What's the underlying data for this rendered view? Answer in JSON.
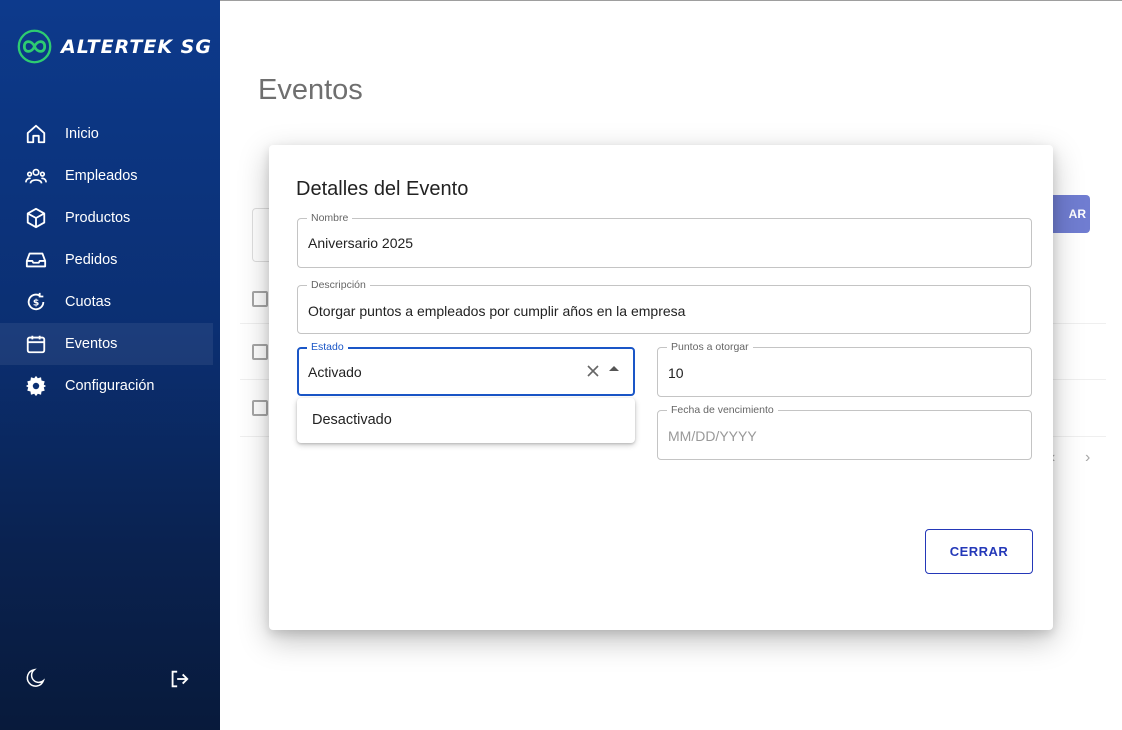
{
  "brand": {
    "name": "ALTERTEK SG",
    "accent": "#2ecc71"
  },
  "sidebar": {
    "items": [
      {
        "label": "Inicio",
        "icon": "home-icon"
      },
      {
        "label": "Empleados",
        "icon": "users-icon"
      },
      {
        "label": "Productos",
        "icon": "cube-icon"
      },
      {
        "label": "Pedidos",
        "icon": "inbox-icon"
      },
      {
        "label": "Cuotas",
        "icon": "refresh-dollar-icon"
      },
      {
        "label": "Eventos",
        "icon": "calendar-icon",
        "active": true
      },
      {
        "label": "Configuración",
        "icon": "gear-icon"
      }
    ],
    "bottom": {
      "theme_icon": "moon-icon",
      "logout_icon": "logout-icon"
    }
  },
  "page": {
    "title": "Eventos",
    "button_partial": "AR"
  },
  "dialog": {
    "title": "Detalles del Evento",
    "fields": {
      "nombre": {
        "label": "Nombre",
        "value": "Aniversario 2025"
      },
      "descripcion": {
        "label": "Descripción",
        "value": "Otorgar puntos a empleados por cumplir años en la empresa"
      },
      "estado": {
        "label": "Estado",
        "value": "Activado"
      },
      "puntos": {
        "label": "Puntos a otorgar",
        "value": "10"
      },
      "fecha": {
        "label": "Fecha de vencimiento",
        "placeholder": "MM/DD/YYYY"
      }
    },
    "estado_options": [
      "Desactivado"
    ],
    "close_label": "CERRAR"
  },
  "colors": {
    "primary": "#2438b8",
    "focus": "#1a56c7",
    "sidebar": "#0b2f72"
  }
}
